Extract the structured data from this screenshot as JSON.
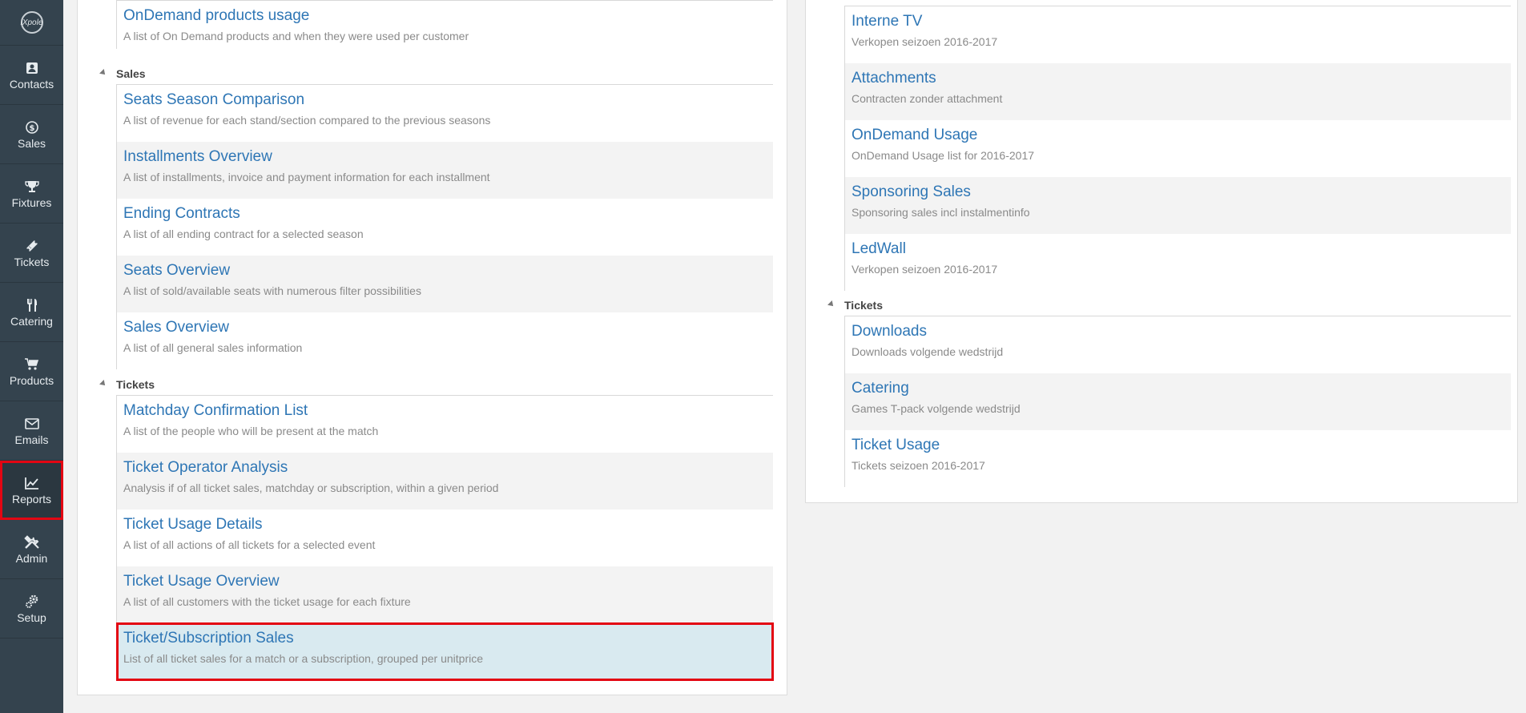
{
  "app": {
    "logo_text": "iXpole"
  },
  "sidebar": {
    "items": [
      {
        "label": "Contacts",
        "icon": "contacts-icon"
      },
      {
        "label": "Sales",
        "icon": "dollar-icon"
      },
      {
        "label": "Fixtures",
        "icon": "trophy-icon"
      },
      {
        "label": "Tickets",
        "icon": "ticket-icon"
      },
      {
        "label": "Catering",
        "icon": "cutlery-icon"
      },
      {
        "label": "Products",
        "icon": "cart-icon"
      },
      {
        "label": "Emails",
        "icon": "envelope-icon"
      },
      {
        "label": "Reports",
        "icon": "chart-icon",
        "active": true
      },
      {
        "label": "Admin",
        "icon": "tools-icon"
      },
      {
        "label": "Setup",
        "icon": "gears-icon"
      }
    ]
  },
  "left": {
    "top_partial": {
      "items": [
        {
          "title": "OnDemand products usage",
          "desc": "A list of On Demand products and when they were used per customer"
        }
      ]
    },
    "sales": {
      "name": "Sales",
      "items": [
        {
          "title": "Seats Season Comparison",
          "desc": "A list of revenue for each stand/section compared to the previous seasons"
        },
        {
          "title": "Installments Overview",
          "desc": "A list of installments, invoice and payment information for each installment"
        },
        {
          "title": "Ending Contracts",
          "desc": "A list of all ending contract for a selected season"
        },
        {
          "title": "Seats Overview",
          "desc": "A list of sold/available seats with numerous filter possibilities"
        },
        {
          "title": "Sales Overview",
          "desc": "A list of all general sales information"
        }
      ]
    },
    "tickets": {
      "name": "Tickets",
      "items": [
        {
          "title": "Matchday Confirmation List",
          "desc": "A list of the people who will be present at the match"
        },
        {
          "title": "Ticket Operator Analysis",
          "desc": "Analysis if of all ticket sales, matchday or subscription, within a given period"
        },
        {
          "title": "Ticket Usage Details",
          "desc": "A list of all actions of all tickets for a selected event"
        },
        {
          "title": "Ticket Usage Overview",
          "desc": "A list of all customers with the ticket usage for each fixture"
        },
        {
          "title": "Ticket/Subscription Sales",
          "desc": "List of all ticket sales for a match or a subscription, grouped per unitprice"
        }
      ]
    }
  },
  "right": {
    "top_partial": {
      "items": [
        {
          "title": "Interne TV",
          "desc": "Verkopen seizoen 2016-2017"
        },
        {
          "title": "Attachments",
          "desc": "Contracten zonder attachment"
        },
        {
          "title": "OnDemand Usage",
          "desc": "OnDemand Usage list for 2016-2017"
        },
        {
          "title": "Sponsoring Sales",
          "desc": "Sponsoring sales incl instalmentinfo"
        },
        {
          "title": "LedWall",
          "desc": "Verkopen seizoen 2016-2017"
        }
      ]
    },
    "tickets": {
      "name": "Tickets",
      "items": [
        {
          "title": "Downloads",
          "desc": "Downloads volgende wedstrijd"
        },
        {
          "title": "Catering",
          "desc": "Games T-pack volgende wedstrijd"
        },
        {
          "title": "Ticket Usage",
          "desc": "Tickets seizoen 2016-2017"
        }
      ]
    }
  }
}
